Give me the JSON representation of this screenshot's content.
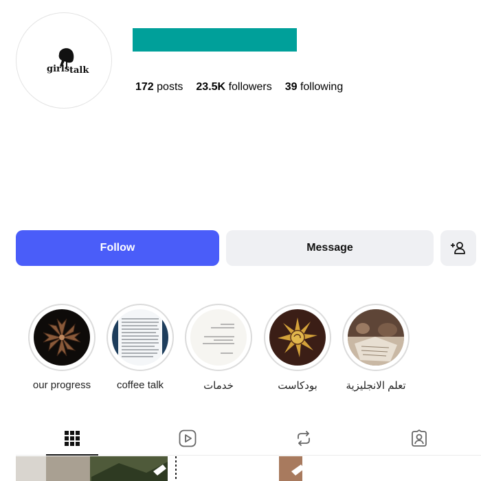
{
  "colors": {
    "accent": "#4a5df9",
    "username_bar": "#00a09a",
    "button_bg": "#eff0f3"
  },
  "profile": {
    "logo_text_left": "girls",
    "logo_text_right": "talk",
    "stats": {
      "posts_count": "172",
      "posts_label": "posts",
      "followers_count": "23.5K",
      "followers_label": "followers",
      "following_count": "39",
      "following_label": "following"
    }
  },
  "actions": {
    "follow_label": "Follow",
    "message_label": "Message",
    "add_icon": "person-add-icon"
  },
  "highlights": [
    {
      "label": "our progress",
      "icon": "flower-icon"
    },
    {
      "label": "coffee talk",
      "icon": "document-icon"
    },
    {
      "label": "خدمات",
      "icon": "document-icon"
    },
    {
      "label": "بودكاست",
      "icon": "sun-icon"
    },
    {
      "label": "تعلم الانجليزية",
      "icon": "photo-icon"
    }
  ],
  "tabs": [
    {
      "name": "posts",
      "icon": "grid-icon",
      "active": true
    },
    {
      "name": "reels",
      "icon": "reels-icon"
    },
    {
      "name": "reposts",
      "icon": "repost-icon"
    },
    {
      "name": "tagged",
      "icon": "tagged-icon"
    }
  ]
}
